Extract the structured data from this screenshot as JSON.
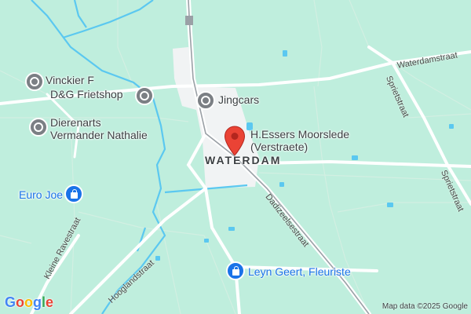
{
  "map": {
    "place_name": "WATERDAM",
    "pois": [
      {
        "name": "Vinckier F",
        "type": "gray"
      },
      {
        "name": "D&G Frietshop",
        "type": "gray"
      },
      {
        "name": "Jingcars",
        "type": "gray"
      },
      {
        "name_line1": "Dierenarts",
        "name_line2": "Vermander Nathalie",
        "type": "gray"
      },
      {
        "name_line1": "H.Essers Moorslede",
        "name_line2": "(Verstraete)",
        "type": "pin"
      },
      {
        "name": "Euro Joe",
        "type": "shop"
      },
      {
        "name": "Leyn Geert, Fleuriste",
        "type": "shop"
      }
    ],
    "streets": [
      "Waterdamstraat",
      "Sprietstraat",
      "Sprietstraat",
      "Dadizeelsestraat",
      "Kleine Ravestraat",
      "Hooglandstraat"
    ],
    "icons": [
      "location-pin-icon",
      "shopping-bag-icon",
      "place-marker-icon"
    ],
    "colors": {
      "land": "#bfeedd",
      "water": "#5bc8f0",
      "road": "#ffffff",
      "built": "#f1f3f4",
      "pin": "#ea4335",
      "poi_gray": "#7b7f84",
      "poi_blue": "#1a73e8"
    }
  },
  "footer": {
    "logo_letters": [
      "G",
      "o",
      "o",
      "g",
      "l",
      "e"
    ],
    "attribution": "Map data ©2025 Google"
  }
}
